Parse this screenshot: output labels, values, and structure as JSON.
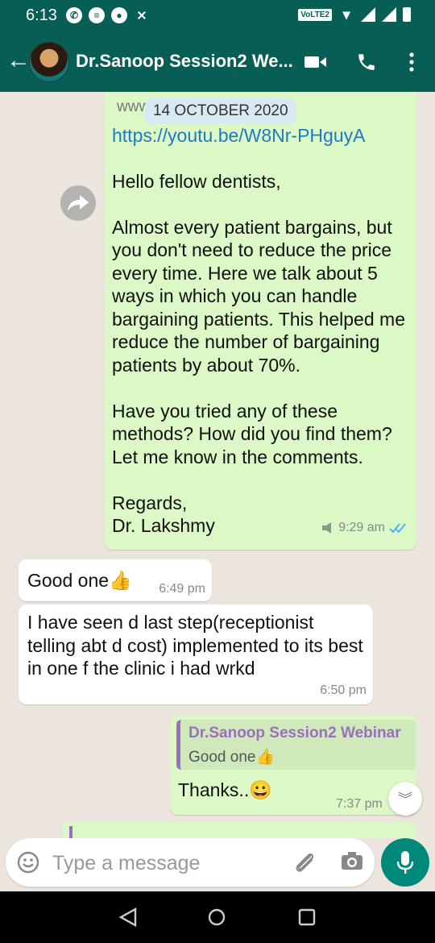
{
  "status_bar": {
    "time": "6:13",
    "network_badge": "VoLTE2"
  },
  "header": {
    "title": "Dr.Sanoop Session2 We...",
    "icons": [
      "back-arrow-icon",
      "avatar",
      "video-call-icon",
      "voice-call-icon",
      "more-options-icon"
    ]
  },
  "chat": {
    "date_label": "14 OCTOBER 2020",
    "partial_preview_text": "www",
    "messages": [
      {
        "direction": "outgoing",
        "link": "https://youtu.be/W8Nr-PHguyA",
        "text": "Hello fellow dentists,\n\nAlmost every patient bargains, but you don't need to reduce the price every time. Here we talk about 5 ways in which you can handle bargaining patients. This helped me reduce the number of bargaining patients by about 70%.\n\nHave you tried any of these methods? How did you find them? Let me know in the comments.\n\nRegards,\nDr. Lakshmy",
        "time": "9:29 am"
      },
      {
        "direction": "incoming",
        "text": "Good one👍",
        "time": "6:49 pm"
      },
      {
        "direction": "incoming",
        "text": "I have seen d last step(receptionist telling abt d cost) implemented to its best in one f the clinic i had wrkd",
        "time": "6:50 pm"
      },
      {
        "direction": "outgoing",
        "quote": {
          "name": "Dr.Sanoop Session2 Webinar",
          "text": "Good one👍"
        },
        "text": "Thanks..😀",
        "time": "7:37 pm"
      }
    ]
  },
  "composer": {
    "placeholder": "Type a message"
  },
  "colors": {
    "header": "#075e54",
    "outgoing_bubble": "#dcf8c6",
    "incoming_bubble": "#ffffff",
    "mic_button": "#00897b",
    "link": "#1f7bbf",
    "read_tick": "#4fb6ec"
  }
}
